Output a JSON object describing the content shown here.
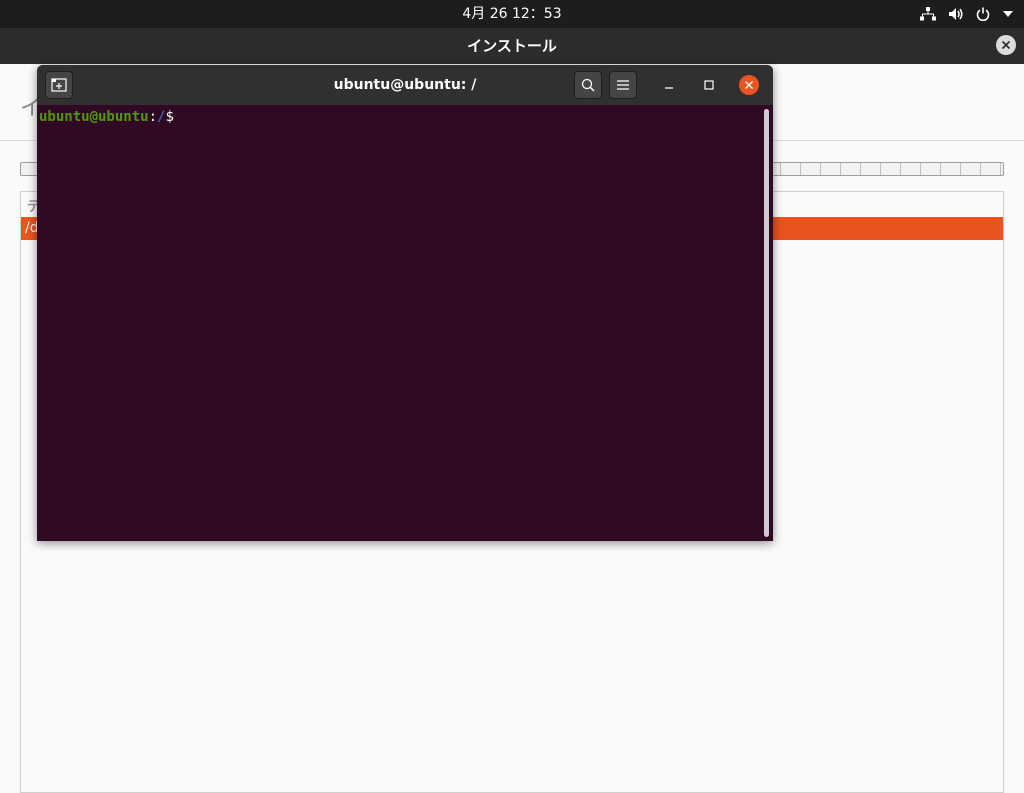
{
  "topbar": {
    "datetime": "4月 26  12：53",
    "icons": [
      "network-icon",
      "volume-icon",
      "power-icon",
      "menu-down-icon"
    ]
  },
  "installer": {
    "title": "インストール",
    "heading": "イ",
    "partition_header": "デ",
    "partition_row": "/d",
    "accent": "#e95420"
  },
  "terminal": {
    "title": "ubuntu@ubuntu: /",
    "prompt_user": "ubuntu@ubuntu",
    "prompt_colon": ":",
    "prompt_path": "/",
    "prompt_symbol": "$",
    "background": "#300a24",
    "user_color": "#4e9a06",
    "path_color": "#3465a4"
  }
}
